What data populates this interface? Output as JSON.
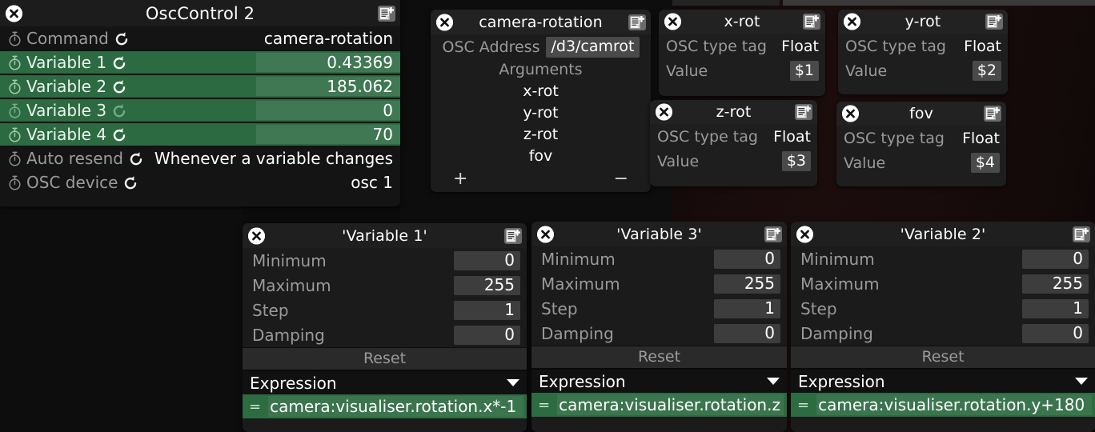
{
  "osc_control": {
    "title": "OscControl 2",
    "close_icon": "close-icon",
    "note_icon": "note-add-icon",
    "rows": [
      {
        "label": "Command",
        "value": "camera-rotation",
        "icon": "stopwatch-icon",
        "reset_icon": "reset-arrow-icon"
      },
      {
        "label": "Variable 1",
        "value": "0.43369",
        "icon": "stopwatch-icon",
        "reset_icon": "reset-arrow-icon"
      },
      {
        "label": "Variable 2",
        "value": "185.062",
        "icon": "stopwatch-icon",
        "reset_icon": "reset-arrow-icon"
      },
      {
        "label": "Variable 3",
        "value": "0",
        "icon": "stopwatch-icon",
        "reset_icon": "reset-arrow-icon"
      },
      {
        "label": "Variable 4",
        "value": "70",
        "icon": "stopwatch-icon",
        "reset_icon": "reset-arrow-icon"
      },
      {
        "label": "Auto resend",
        "value": "Whenever a variable changes",
        "icon": "stopwatch-icon",
        "reset_icon": "reset-arrow-icon"
      },
      {
        "label": "OSC device",
        "value": "osc 1",
        "icon": "stopwatch-icon",
        "reset_icon": "reset-arrow-icon"
      }
    ]
  },
  "command_panel": {
    "title": "camera-rotation",
    "address_label": "OSC Address",
    "address_value": "/d3/camrot",
    "arguments_label": "Arguments",
    "arguments": [
      "x-rot",
      "y-rot",
      "z-rot",
      "fov"
    ],
    "add_label": "+",
    "remove_label": "−"
  },
  "arg_panels": [
    {
      "id": "xrot",
      "title": "x-rot",
      "type_tag_label": "OSC type tag",
      "type_tag_value": "Float",
      "value_label": "Value",
      "value": "$1",
      "header_hover": false
    },
    {
      "id": "yrot",
      "title": "y-rot",
      "type_tag_label": "OSC type tag",
      "type_tag_value": "Float",
      "value_label": "Value",
      "value": "$2",
      "header_hover": false
    },
    {
      "id": "zrot",
      "title": "z-rot",
      "type_tag_label": "OSC type tag",
      "type_tag_value": "Float",
      "value_label": "Value",
      "value": "$3",
      "header_hover": false
    },
    {
      "id": "fov",
      "title": "fov",
      "type_tag_label": "OSC type tag",
      "type_tag_value": "Float",
      "value_label": "Value",
      "value": "$4",
      "header_hover": true
    }
  ],
  "var_panels": [
    {
      "id": "var1",
      "title": "'Variable 1'",
      "minimum_label": "Minimum",
      "minimum": "0",
      "maximum_label": "Maximum",
      "maximum": "255",
      "step_label": "Step",
      "step": "1",
      "damping_label": "Damping",
      "damping": "0",
      "reset_label": "Reset",
      "expression_label": "Expression",
      "equals_sign": "=",
      "expression": "camera:visualiser.rotation.x*-1"
    },
    {
      "id": "var3",
      "title": "'Variable 3'",
      "minimum_label": "Minimum",
      "minimum": "0",
      "maximum_label": "Maximum",
      "maximum": "255",
      "step_label": "Step",
      "step": "1",
      "damping_label": "Damping",
      "damping": "0",
      "reset_label": "Reset",
      "expression_label": "Expression",
      "equals_sign": "=",
      "expression": "camera:visualiser.rotation.z"
    },
    {
      "id": "var2",
      "title": "'Variable 2'",
      "minimum_label": "Minimum",
      "minimum": "0",
      "maximum_label": "Maximum",
      "maximum": "255",
      "step_label": "Step",
      "step": "1",
      "damping_label": "Damping",
      "damping": "0",
      "reset_label": "Reset",
      "expression_label": "Expression",
      "equals_sign": "=",
      "expression": "camera:visualiser.rotation.y+180"
    }
  ],
  "colors": {
    "accent_green": "#2c6b42",
    "expression_green": "#2d6b41",
    "panel_bg": "#1b1b1b",
    "panel_head": "#1f1f1f",
    "field_bg": "#3d3d3d",
    "muted_text": "#9a9a9a",
    "bright_text": "#ffffff",
    "desktop_bg": "#0b0b0b",
    "desktop_red": "#1c0d0d"
  }
}
